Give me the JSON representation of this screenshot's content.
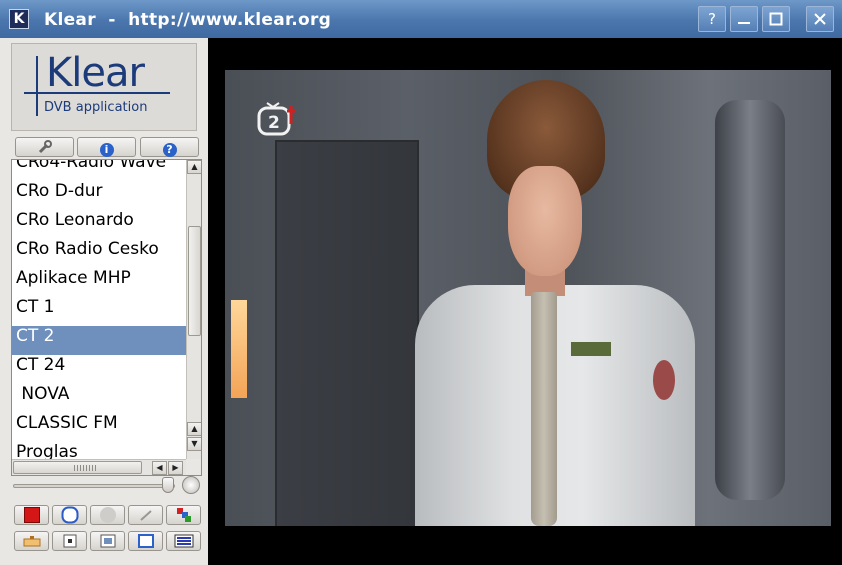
{
  "window": {
    "title": "Klear  -  http://www.klear.org",
    "app_icon_letter": "K",
    "buttons": {
      "help": "?",
      "minimize": "_",
      "maximize": "□",
      "close": "✕"
    }
  },
  "logo": {
    "word": "Klear",
    "subtitle": "DVB application"
  },
  "toolbar": {
    "settings_icon": "wrench-icon",
    "info_icon": "info-icon",
    "help_icon": "help-icon"
  },
  "channels": {
    "items": [
      "CRo4-Radio Wave",
      "CRo D-dur",
      "CRo Leonardo",
      "CRo Radio Cesko",
      "Aplikace MHP",
      "CT 1",
      "CT 2",
      "CT 24",
      " NOVA",
      "CLASSIC FM",
      "Proglas"
    ],
    "selected": "CT 2"
  },
  "volume": {
    "level": 0.95
  },
  "controls": {
    "row1": [
      "record-icon",
      "timer-icon",
      "play-icon",
      "eject-icon",
      "channel-scan-icon"
    ],
    "row2": [
      "osd-icon",
      "aspect-icon",
      "fullscreen-icon",
      "minimal-mode-icon",
      "teletext-icon"
    ]
  },
  "video": {
    "channel_logo_text": "2"
  },
  "colors": {
    "titlebar": "#4a76ad",
    "selection": "#6f90bd",
    "logo_blue": "#1c3b7a"
  }
}
